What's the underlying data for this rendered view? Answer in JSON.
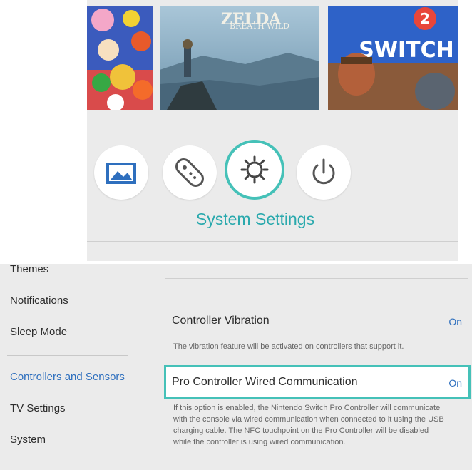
{
  "home": {
    "tiles": [
      {
        "name": "game-tile-left",
        "artwork": "colorful-characters"
      },
      {
        "name": "game-tile-middle",
        "logo_text": "ZELDA",
        "subtitle_text": "BREATH WILD"
      },
      {
        "name": "game-tile-right",
        "logo_text": "SWITCH",
        "badge_text": "2"
      }
    ],
    "icons": [
      "album-icon",
      "controller-icon",
      "settings-gear-icon",
      "power-icon"
    ],
    "selected_label": "System Settings",
    "accent_color": "#45c1b8",
    "label_color": "#2aa9ad"
  },
  "settings": {
    "sidebar": {
      "items": [
        {
          "label": "Themes"
        },
        {
          "label": "Notifications"
        },
        {
          "label": "Sleep Mode"
        },
        {
          "label": "Controllers and Sensors",
          "active": true
        },
        {
          "label": "TV Settings"
        },
        {
          "label": "System"
        }
      ],
      "active_color": "#2e6fbe"
    },
    "rows": {
      "vibration": {
        "title": "Controller Vibration",
        "value": "On",
        "description": "The vibration feature will be activated on controllers that support it."
      },
      "pro_wired": {
        "title": "Pro Controller Wired Communication",
        "value": "On",
        "description_lines": [
          "If this option is enabled, the Nintendo Switch Pro Controller will communicate",
          "with the console via wired communication when connected to it using the USB",
          "charging cable. The NFC touchpoint on the Pro Controller will be disabled",
          "while the controller is using wired communication."
        ]
      }
    }
  }
}
